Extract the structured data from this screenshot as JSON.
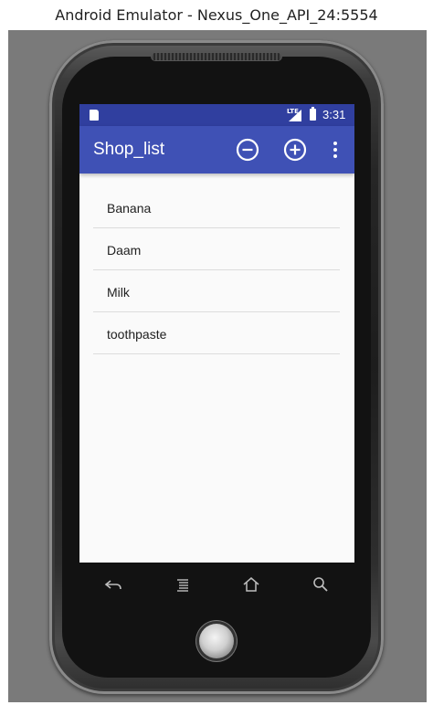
{
  "window": {
    "title": "Android Emulator - Nexus_One_API_24:5554"
  },
  "status_bar": {
    "network_label": "LTE",
    "time": "3:31"
  },
  "app_bar": {
    "title": "Shop_list",
    "actions": [
      {
        "name": "remove",
        "icon": "minus-circle-icon"
      },
      {
        "name": "add",
        "icon": "plus-circle-icon"
      },
      {
        "name": "more",
        "icon": "overflow-menu-icon"
      }
    ]
  },
  "list": {
    "items": [
      "Banana",
      "Daam",
      "Milk",
      "toothpaste"
    ]
  },
  "nav_keys": [
    "back-icon",
    "menu-icon",
    "home-icon",
    "search-icon"
  ],
  "colors": {
    "status_bar": "#303f9f",
    "app_bar": "#3f51b5",
    "screen_background": "#fafafa",
    "emulator_background": "#7a7a7a"
  }
}
